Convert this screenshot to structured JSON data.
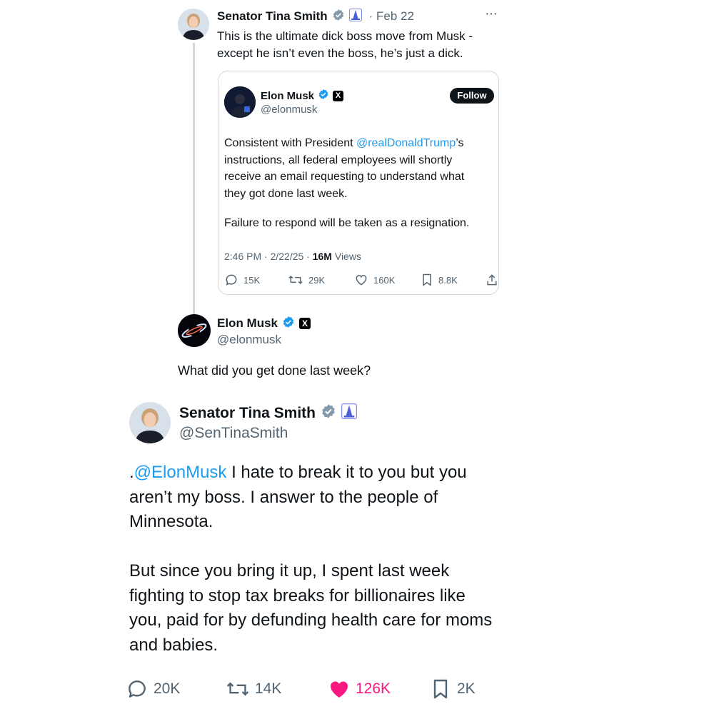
{
  "reply": {
    "author": "Senator Tina Smith",
    "date": "· Feb 22",
    "more": "···",
    "text_line1": "This is the ultimate dick boss move from Musk -",
    "text_line2": "except he isn’t even the boss, he’s just a dick."
  },
  "quoted": {
    "name": "Elon Musk",
    "x_badge": "X",
    "handle": "@elonmusk",
    "follow_label": "Follow",
    "p1_pre": "Consistent with President ",
    "p1_mention": "@realDonaldTrump",
    "p1_post": "’s",
    "p1_line2": "instructions, all federal employees will shortly",
    "p1_line3": "receive an email requesting to understand what",
    "p1_line4": "they got done last week.",
    "p2": "Failure to respond will be taken as a resignation.",
    "meta_time": "2:46 PM · 2/22/25 · ",
    "meta_views_count": "16M",
    "meta_views_label": " Views",
    "replies": "15K",
    "reposts": "29K",
    "likes": "160K",
    "bookmarks": "8.8K"
  },
  "musk_reply": {
    "name": "Elon Musk",
    "x_badge": "X",
    "handle": "@elonmusk",
    "text": "What did you get done last week?"
  },
  "main": {
    "name": "Senator Tina Smith",
    "handle": "@SenTinaSmith",
    "p1_mention": "@ElonMusk",
    "p1_line1_pre": ".",
    "p1_line1_post": " I hate to break it to you but you",
    "p1_line2": "aren’t my boss. I answer to the people of",
    "p1_line3": "Minnesota.",
    "p2_line1": "But since you bring it up, I spent last week",
    "p2_line2": "fighting to stop tax breaks for billionaires like",
    "p2_line3": "you, paid for by defunding health care for moms",
    "p2_line4": "and babies.",
    "replies": "20K",
    "reposts": "14K",
    "likes": "126K",
    "bookmarks": "2K"
  },
  "icons": {
    "verified": "verified-badge-icon",
    "capitol": "capitol-affiliation-icon",
    "reply": "reply-icon",
    "repost": "repost-icon",
    "like": "heart-icon",
    "bookmark": "bookmark-icon",
    "share": "share-icon"
  },
  "colors": {
    "accent": "#1d9bf0",
    "like_active": "#f91880",
    "muted": "#536471"
  }
}
